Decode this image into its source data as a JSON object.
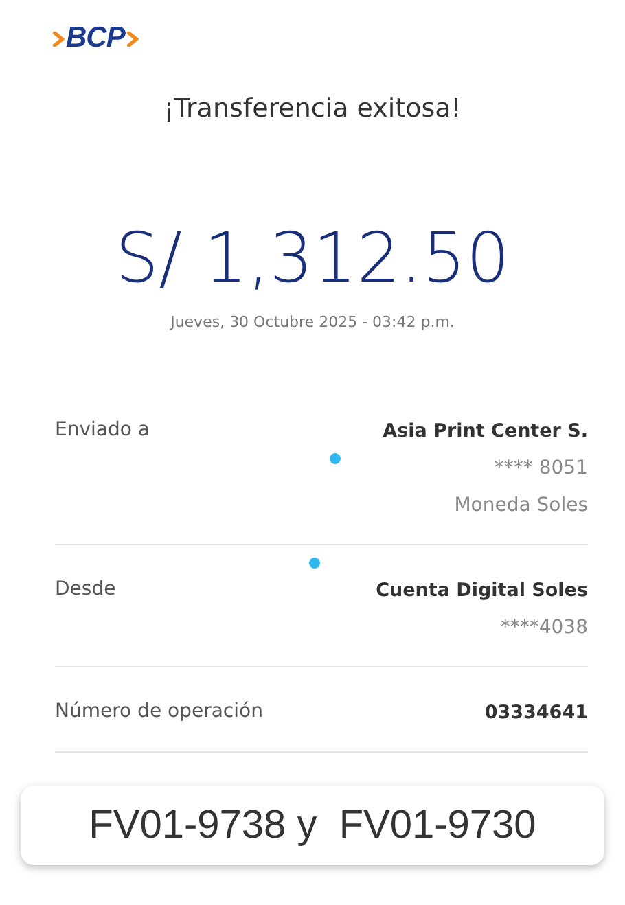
{
  "logo": {
    "text": "BCP"
  },
  "title": "¡Transferencia exitosa!",
  "amount": "S/ 1,312.50",
  "datetime": "Jueves, 30 Octubre 2025 - 03:42 p.m.",
  "details": [
    {
      "label": "Enviado a",
      "values": [
        "Asia Print Center S.",
        "**** 8051",
        "Moneda Soles"
      ]
    },
    {
      "label": "Desde",
      "values": [
        "Cuenta Digital Soles",
        "****4038"
      ]
    },
    {
      "label": "Número de operación",
      "values": [
        "03334641"
      ]
    }
  ],
  "note": "FV01-9738 y  FV01-9730"
}
